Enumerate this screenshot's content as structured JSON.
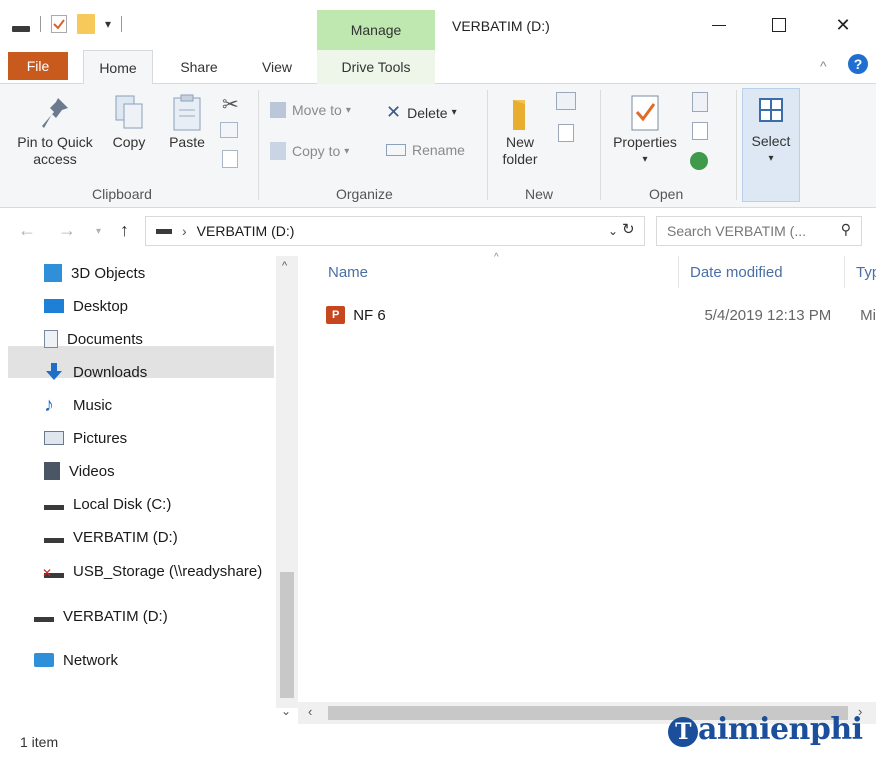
{
  "window": {
    "title": "VERBATIM (D:)",
    "context_tab_group": "Manage",
    "minimize": "—",
    "maximize": "☐",
    "close": "✕"
  },
  "tabs": {
    "file": "File",
    "home": "Home",
    "share": "Share",
    "view": "View",
    "drive_tools": "Drive Tools"
  },
  "ribbon": {
    "clipboard": {
      "label": "Clipboard",
      "pin": "Pin to Quick access",
      "copy": "Copy",
      "paste": "Paste"
    },
    "organize": {
      "label": "Organize",
      "move_to": "Move to",
      "copy_to": "Copy to",
      "delete": "Delete",
      "rename": "Rename"
    },
    "new": {
      "label": "New",
      "new_folder": "New folder"
    },
    "open": {
      "label": "Open",
      "properties": "Properties"
    },
    "select": {
      "label": "Select"
    }
  },
  "address": {
    "path": "VERBATIM (D:)",
    "search_placeholder": "Search VERBATIM (..."
  },
  "nav_pane": {
    "items": [
      {
        "label": "3D Objects",
        "icon": "3d-objects-icon"
      },
      {
        "label": "Desktop",
        "icon": "desktop-icon"
      },
      {
        "label": "Documents",
        "icon": "documents-icon"
      },
      {
        "label": "Downloads",
        "icon": "downloads-icon"
      },
      {
        "label": "Music",
        "icon": "music-icon"
      },
      {
        "label": "Pictures",
        "icon": "pictures-icon"
      },
      {
        "label": "Videos",
        "icon": "videos-icon"
      },
      {
        "label": "Local Disk (C:)",
        "icon": "local-disk-icon"
      },
      {
        "label": "VERBATIM (D:)",
        "icon": "drive-icon"
      },
      {
        "label": "USB_Storage (\\\\readyshare)",
        "icon": "network-drive-icon"
      }
    ],
    "selected_drive": "VERBATIM (D:)",
    "network": "Network"
  },
  "content": {
    "columns": {
      "name": "Name",
      "date_modified": "Date modified",
      "type": "Typ"
    },
    "files": [
      {
        "name": "NF 6",
        "date_modified": "5/4/2019 12:13 PM",
        "type": "Mi",
        "icon": "powerpoint-file-icon"
      }
    ]
  },
  "status": {
    "item_count": "1 item"
  },
  "watermark": {
    "text": "aimienphi",
    "initial": "T"
  },
  "colors": {
    "file_tab": "#c85a1e",
    "manage_tab": "#bfe7b0",
    "selection": "#e2e2e2",
    "header_text": "#4a6fa5"
  }
}
